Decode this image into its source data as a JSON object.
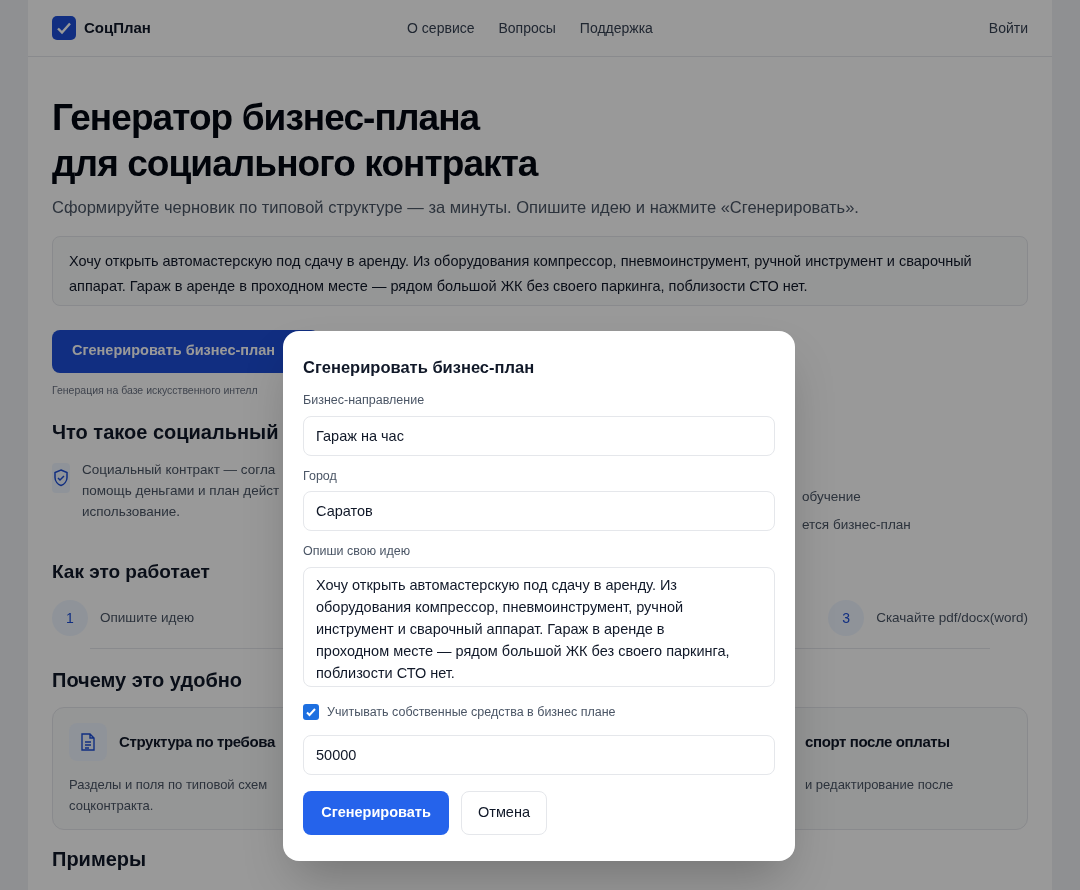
{
  "header": {
    "logo": "СоцПлан",
    "nav": [
      "О сервисе",
      "Вопросы",
      "Поддержка"
    ],
    "login": "Войти"
  },
  "hero": {
    "title_lines": [
      "Генератор бизнес-плана",
      "для социального контракта"
    ],
    "subtitle": "Сформируйте черновик по типовой структуре — за минуты. Опишите идею и нажмите «Сгенерировать».",
    "idea_text": "Хочу открыть автомастерскую под сдачу в аренду. Из оборудования компрессор, пневмоинструмент, ручной инструмент и сварочный аппарат. Гараж в аренде в проходном месте — рядом большой ЖК без своего паркинга, поблизости СТО нет.",
    "generate_button": "Сгенерировать бизнес-план",
    "note": "Генерация на базе искусственного интелл"
  },
  "about": {
    "heading": "Что такое социальный",
    "left_lines": [
      "Социальный контракт — согла",
      "помощь деньгами и план дейст",
      "использование."
    ],
    "right_lines": [
      "обучение",
      "ется бизнес-план"
    ]
  },
  "how": {
    "heading": "Как это работает",
    "steps": [
      {
        "number": "1",
        "label": "Опишите идею"
      },
      {
        "number": "3",
        "label": "Скачайте pdf/docx(word)"
      }
    ]
  },
  "why": {
    "heading": "Почему это удобно",
    "cards": [
      {
        "title": "Структура по требова",
        "lines": [
          "Разделы и поля по типовой схем",
          "соцконтракта."
        ]
      },
      {
        "title": "спорт после оплаты",
        "lines": [
          "и редактирование после"
        ]
      }
    ]
  },
  "examples": {
    "heading": "Примеры"
  },
  "modal": {
    "title": "Сгенерировать бизнес-план",
    "fields": [
      {
        "label": "Бизнес-направление",
        "value": "Гараж на час"
      },
      {
        "label": "Город",
        "value": "Саратов"
      }
    ],
    "idea": {
      "label": "Опиши свою идею",
      "value": "Хочу открыть автомастерскую под сдачу в аренду. Из оборудования компрессор, пневмоинструмент, ручной инструмент и сварочный аппарат. Гараж в аренде в проходном месте — рядом большой ЖК без своего паркинга, поблизости СТО нет."
    },
    "own_funds": {
      "label": "Учитывать собственные средства в бизнес плане",
      "checked": true,
      "value": "50000"
    },
    "submit": "Сгенерировать",
    "cancel": "Отмена"
  }
}
